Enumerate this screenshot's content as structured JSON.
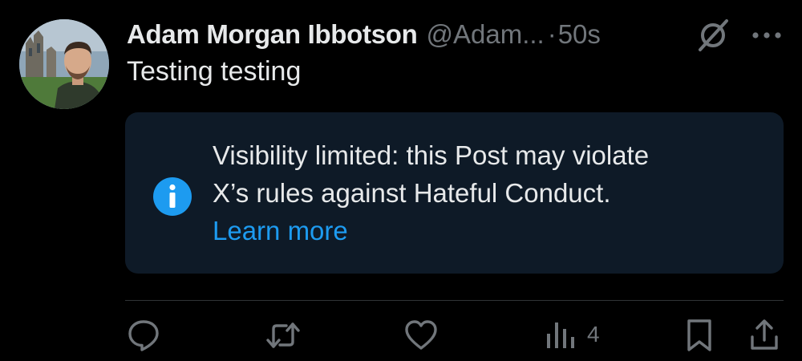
{
  "post": {
    "author_name": "Adam Morgan Ibbotson",
    "author_handle": "@Adam...",
    "separator": "·",
    "timestamp": "50s",
    "text": "Testing testing"
  },
  "notice": {
    "line1": "Visibility limited: this Post may violate",
    "line2": "X’s rules against Hateful Conduct.",
    "link": "Learn more"
  },
  "actions": {
    "views_count": "4"
  },
  "icons": {
    "avatar": "profile-photo",
    "edit": "grok-icon",
    "more": "more-icon",
    "info": "info-icon",
    "reply": "reply-icon",
    "repost": "repost-icon",
    "like": "like-icon",
    "views": "views-icon",
    "bookmark": "bookmark-icon",
    "share": "share-icon"
  },
  "colors": {
    "background": "#000000",
    "primary_text": "#e7e9ea",
    "secondary_text": "#71767b",
    "accent": "#1d9bf0",
    "notice_background": "#0e1a27",
    "divider": "#2f3336"
  }
}
